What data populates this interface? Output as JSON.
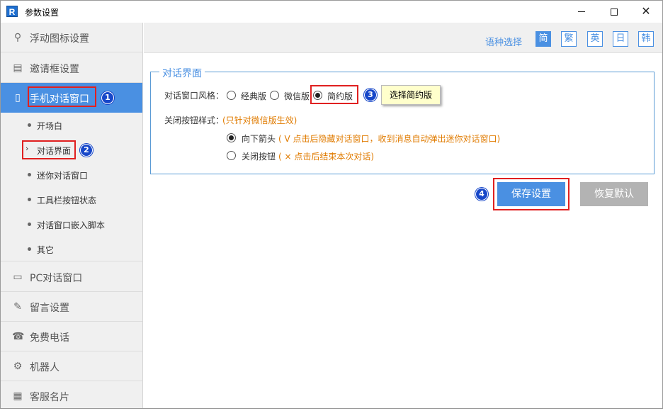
{
  "window": {
    "app_icon": "R",
    "title": "参数设置",
    "minimize": "minimize-icon",
    "maximize": "maximize-icon",
    "close": "✕"
  },
  "sidebar": {
    "items": [
      {
        "label": "浮动图标设置",
        "icon": "pin-icon"
      },
      {
        "label": "邀请框设置",
        "icon": "document-icon"
      },
      {
        "label": "手机对话窗口",
        "icon": "phone-icon",
        "active": true
      },
      {
        "label": "PC对话窗口",
        "icon": "monitor-icon"
      },
      {
        "label": "留言设置",
        "icon": "edit-icon"
      },
      {
        "label": "免费电话",
        "icon": "telephone-icon"
      },
      {
        "label": "机器人",
        "icon": "robot-icon"
      },
      {
        "label": "客服名片",
        "icon": "card-icon"
      }
    ],
    "subitems": [
      {
        "label": "开场白"
      },
      {
        "label": "对话界面",
        "selected": true
      },
      {
        "label": "迷你对话窗口"
      },
      {
        "label": "工具栏按钮状态"
      },
      {
        "label": "对话窗口嵌入脚本"
      },
      {
        "label": "其它"
      }
    ]
  },
  "language": {
    "label": "语种选择",
    "options": [
      "简",
      "繁",
      "英",
      "日",
      "韩"
    ],
    "selected": "简"
  },
  "panel": {
    "legend": "对话界面",
    "style_label": "对话窗口风格：",
    "style_options": [
      "经典版",
      "微信版",
      "简约版"
    ],
    "style_selected": "简约版",
    "tooltip": "选择简约版",
    "close_label": "关闭按钮样式：",
    "close_hint": "(只针对微信版生效)",
    "close_options": [
      {
        "label": "向下箭头",
        "hint": "( V 点击后隐藏对话窗口，收到消息自动弹出迷你对话窗口)",
        "checked": true
      },
      {
        "label": "关闭按钮",
        "hint": "( × 点击后结束本次对话)",
        "checked": false
      }
    ]
  },
  "actions": {
    "save": "保存设置",
    "reset": "恢复默认"
  },
  "badges": [
    "1",
    "2",
    "3",
    "4"
  ],
  "colors": {
    "accent": "#4a90e2",
    "annotation_red": "#e02020",
    "badge_blue": "#1747c9",
    "hint_orange": "#e07b00"
  }
}
